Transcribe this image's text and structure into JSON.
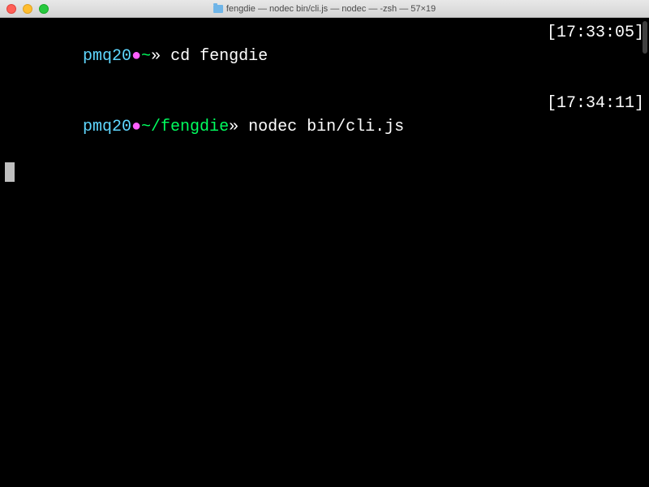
{
  "window": {
    "title": "fengdie — nodec bin/cli.js — nodec — -zsh — 57×19"
  },
  "lines": [
    {
      "user": "pmq20",
      "dot": "●",
      "path": "~",
      "arrow": "» ",
      "command": "cd fengdie",
      "timestamp": "[17:33:05]"
    },
    {
      "user": "pmq20",
      "dot": "●",
      "path": "~/fengdie",
      "arrow": "» ",
      "command": "nodec bin/cli.js",
      "timestamp": "[17:34:11]"
    }
  ]
}
